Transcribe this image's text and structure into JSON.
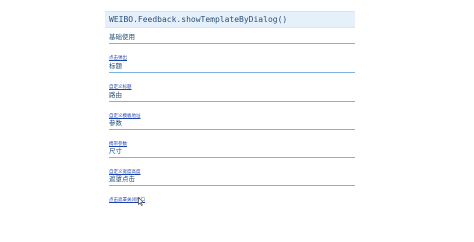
{
  "header": {
    "title": "WEIBO.Feedback.showTemplateByDialog()"
  },
  "sections": [
    {
      "heading": "基础使用",
      "link": "点击弹出"
    },
    {
      "heading": "标题",
      "link": "自定义标题"
    },
    {
      "heading": "路由",
      "link": "自定义模板地址"
    },
    {
      "heading": "参数",
      "link": "携带参数"
    },
    {
      "heading": "尺寸",
      "link": "自定义宽度高度"
    },
    {
      "heading": "遮罩点击",
      "link": "点击遮罩关闭窗口"
    }
  ],
  "cursor_icon": "arrow-cursor-icon"
}
